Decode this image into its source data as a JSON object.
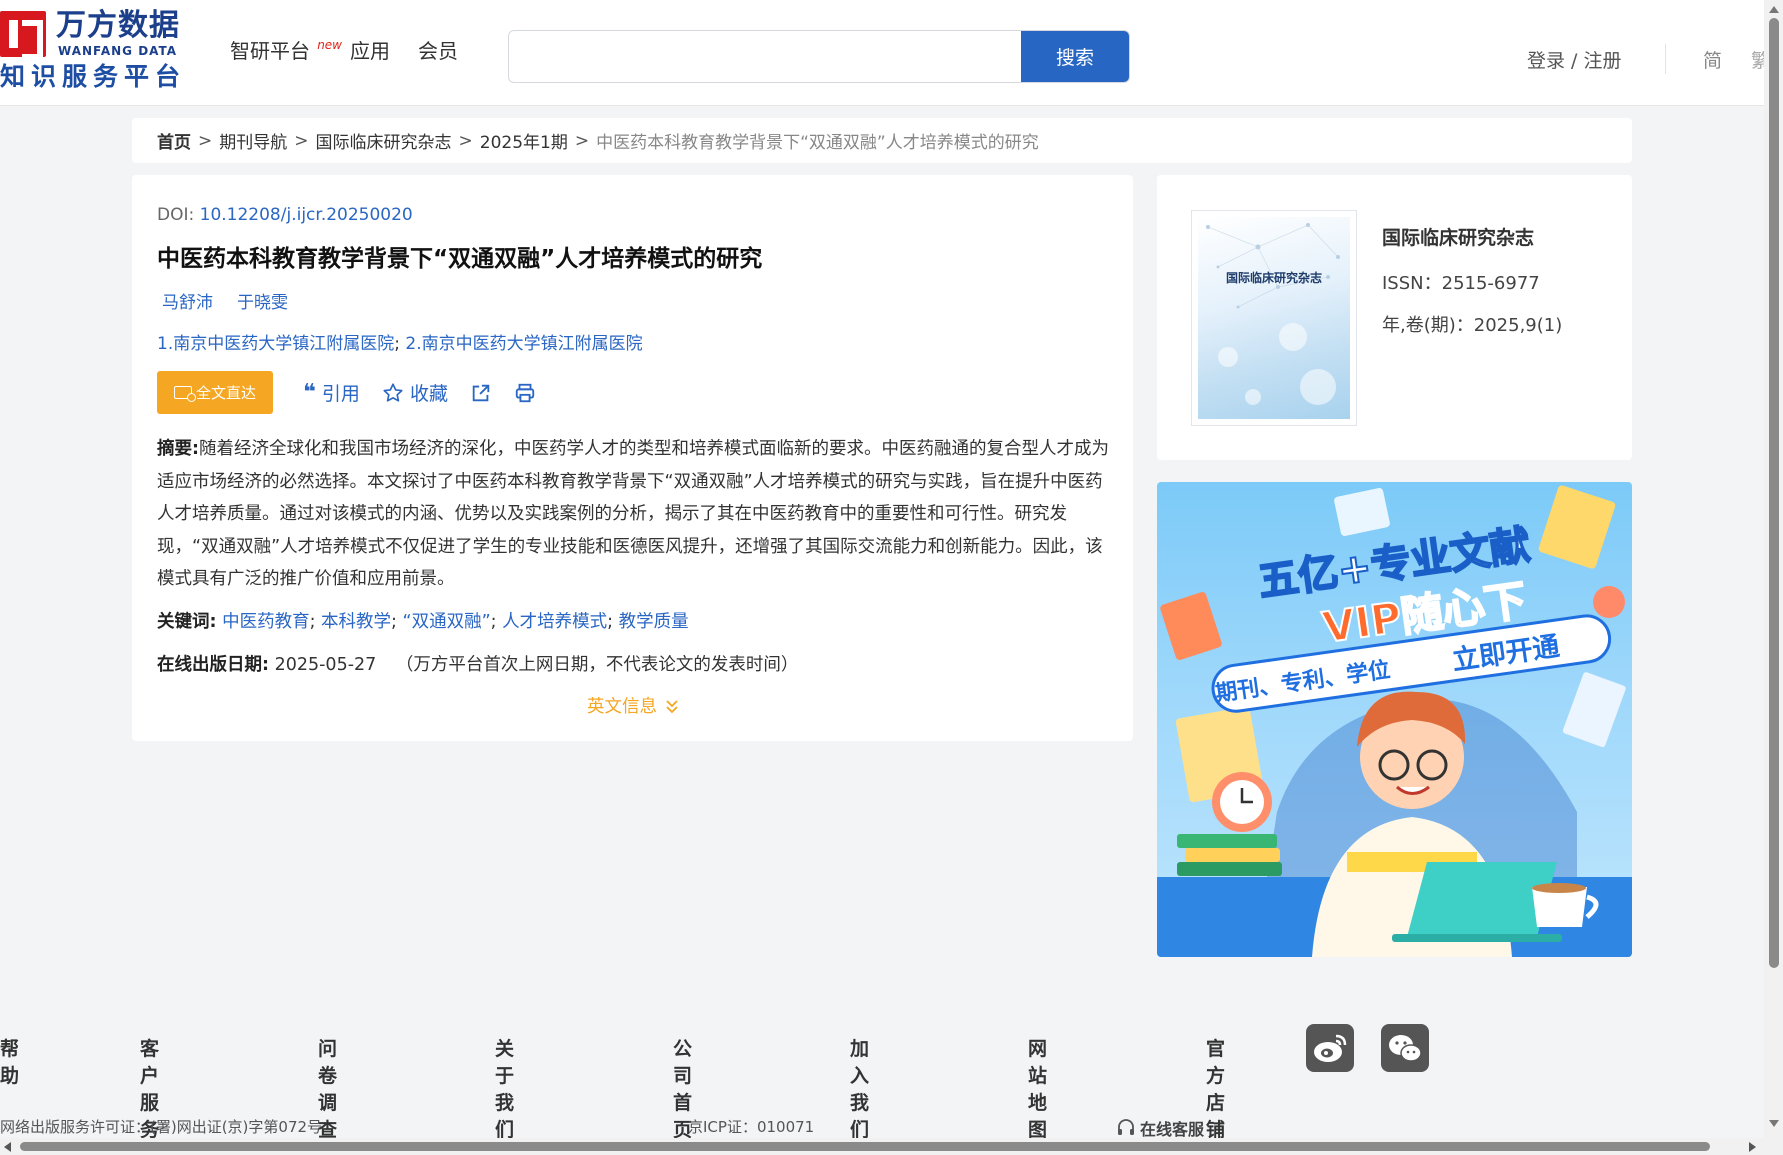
{
  "header": {
    "logo_cn": "万方数据",
    "logo_en": "WANFANG DATA",
    "logo_sub": "知识服务平台",
    "nav": [
      {
        "label": "智研平台",
        "badge": "new"
      },
      {
        "label": "应用"
      },
      {
        "label": "会员"
      }
    ],
    "search": {
      "placeholder": "",
      "button": "搜索"
    },
    "login": "登录 / 注册",
    "lang_simple": "简",
    "lang_traditional": "繁"
  },
  "breadcrumb": {
    "home": "首页",
    "items": [
      "期刊导航",
      "国际临床研究杂志",
      "2025年1期"
    ],
    "current": "中医药本科教育教学背景下“双通双融”人才培养模式的研究",
    "separator": ">"
  },
  "article": {
    "doi_label": "DOI:",
    "doi": "10.12208/j.ijcr.20250020",
    "title": "中医药本科教育教学背景下“双通双融”人才培养模式的研究",
    "authors": [
      "马舒沛",
      "于晓雯"
    ],
    "affiliations": [
      "1.南京中医药大学镇江附属医院",
      "2.南京中医药大学镇江附属医院"
    ],
    "affil_sep": ";",
    "actions": {
      "fulltext": "全文直达",
      "cite": "引用",
      "favorite": "收藏"
    },
    "abstract_label": "摘要:",
    "abstract": "随着经济全球化和我国市场经济的深化，中医药学人才的类型和培养模式面临新的要求。中医药融通的复合型人才成为适应市场经济的必然选择。本文探讨了中医药本科教育教学背景下“双通双融”人才培养模式的研究与实践，旨在提升中医药人才培养质量。通过对该模式的内涵、优势以及实践案例的分析，揭示了其在中医药教育中的重要性和可行性。研究发现，“双通双融”人才培养模式不仅促进了学生的专业技能和医德医风提升，还增强了其国际交流能力和创新能力。因此，该模式具有广泛的推广价值和应用前景。",
    "keywords_label": "关键词:",
    "keywords": [
      "中医药教育",
      "本科教学",
      "“双通双融”",
      "人才培养模式",
      "教学质量"
    ],
    "pubdate_label": "在线出版日期:",
    "pubdate": "2025-05-27",
    "pubdate_note": "（万方平台首次上网日期，不代表论文的发表时间）",
    "english_info": "英文信息"
  },
  "journal": {
    "cover_title": "国际临床研究杂志",
    "name": "国际临床研究杂志",
    "issn": "ISSN：2515-6977",
    "volume": "年,卷(期)：2025,9(1)"
  },
  "ad": {
    "line1": "五亿+专业文献",
    "line2": "VIP随心下",
    "ribbon_left": "期刊、专利、学位",
    "ribbon_right": "立即开通",
    "colors": {
      "bg": "#8dd1fa",
      "title": "#ffffff",
      "vip": "#ff6b2c",
      "ribbon": "#1f6fe0"
    }
  },
  "footer": {
    "links": [
      "帮助",
      "客户服务",
      "问卷调查",
      "关于我们",
      "公司首页",
      "加入我们",
      "网站地图",
      "官方店铺"
    ],
    "social": [
      "weibo-icon",
      "wechat-icon"
    ],
    "license": "网络出版服务许可证：(署)网出证(京)字第072号",
    "icp": "京ICP证：010071",
    "online_service": "在线客服"
  },
  "colors": {
    "brand_red": "#d7191f",
    "brand_blue": "#1b3f8b",
    "link": "#2a66c3",
    "search_button": "#2766c3",
    "orange": "#f5a623"
  }
}
